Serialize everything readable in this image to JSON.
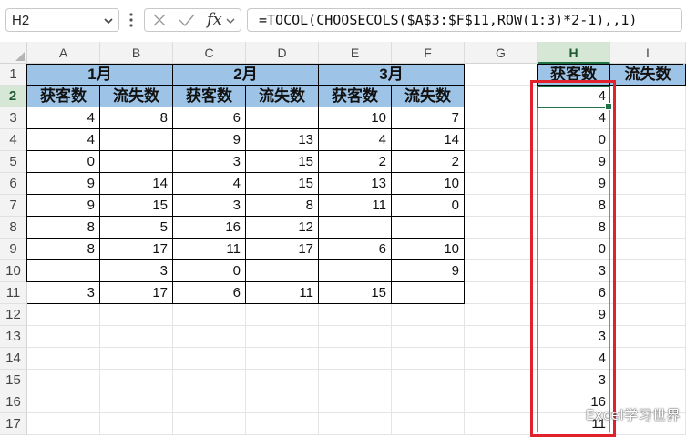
{
  "formula_bar": {
    "name_box": "H2",
    "formula": "=TOCOL(CHOOSECOLS($A$3:$F$11,ROW(1:3)*2-1),,1)",
    "cancel_icon": "close-icon",
    "confirm_icon": "checkmark-icon",
    "fx_label": "fx"
  },
  "sheet": {
    "columns": [
      "A",
      "B",
      "C",
      "D",
      "E",
      "F",
      "G",
      "H",
      "I"
    ],
    "selected_column": "H",
    "selected_row": "2",
    "rows": [
      "1",
      "2",
      "3",
      "4",
      "5",
      "6",
      "7",
      "8",
      "9",
      "10",
      "11",
      "12",
      "13",
      "14",
      "15",
      "16",
      "17"
    ],
    "months": [
      "1月",
      "2月",
      "3月"
    ],
    "subheaders": [
      "获客数",
      "流失数",
      "获客数",
      "流失数",
      "获客数",
      "流失数"
    ],
    "table_rows": [
      [
        "4",
        "8",
        "6",
        "",
        "10",
        "7"
      ],
      [
        "4",
        "",
        "9",
        "13",
        "4",
        "14"
      ],
      [
        "0",
        "",
        "3",
        "15",
        "2",
        "2"
      ],
      [
        "9",
        "14",
        "4",
        "15",
        "13",
        "10"
      ],
      [
        "9",
        "15",
        "3",
        "8",
        "11",
        "0"
      ],
      [
        "8",
        "5",
        "16",
        "12",
        "",
        ""
      ],
      [
        "8",
        "17",
        "11",
        "17",
        "6",
        "10"
      ],
      [
        "",
        "3",
        "0",
        "",
        "",
        "9"
      ],
      [
        "3",
        "17",
        "6",
        "11",
        "15",
        ""
      ]
    ],
    "h_header": "获客数",
    "i_header": "流失数",
    "spill_values": [
      "4",
      "4",
      "0",
      "9",
      "9",
      "8",
      "8",
      "0",
      "3",
      "6",
      "9",
      "3",
      "4",
      "3",
      "16",
      "11"
    ]
  },
  "watermark": "Excel学习世界",
  "colors": {
    "header_fill": "#9dc3e6",
    "highlight_border": "#e1212b",
    "selection": "#217346"
  }
}
